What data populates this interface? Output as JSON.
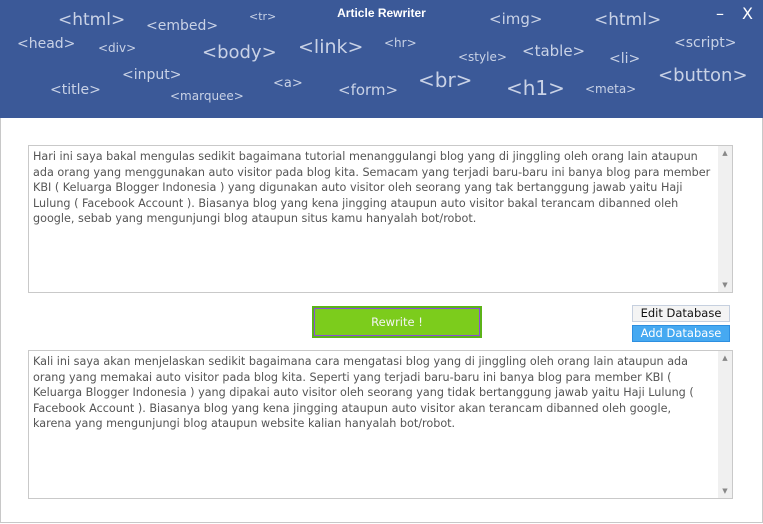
{
  "window": {
    "title": "Article Rewriter",
    "minimize_label": "–",
    "close_label": "X"
  },
  "header_tags": [
    "<html>",
    "<embed>",
    "<tr>",
    "<img>",
    "<html>",
    "<head>",
    "<div>",
    "<body>",
    "<link>",
    "<hr>",
    "<style>",
    "<table>",
    "<li>",
    "<script>",
    "<input>",
    "<title>",
    "<marquee>",
    "<a>",
    "<form>",
    "<br>",
    "<h1>",
    "<meta>",
    "<button>"
  ],
  "colors": {
    "header": "#3b5998",
    "rewrite": "#7ccc1c",
    "add_database": "#46a9f1"
  },
  "input_text": "Hari ini saya bakal mengulas sedikit bagaimana tutorial menanggulangi blog yang di jinggling oleh orang lain ataupun ada orang yang menggunakan auto visitor pada blog kita. Semacam yang terjadi baru-baru ini banya blog para member KBI ( Keluarga Blogger Indonesia ) yang digunakan auto visitor oleh seorang yang tak bertanggung jawab yaitu Haji Lulung ( Facebook Account ). Biasanya blog yang kena jingging ataupun auto visitor bakal terancam dibanned oleh google, sebab yang mengunjungi blog ataupun situs kamu hanyalah bot/robot.",
  "buttons": {
    "rewrite": "Rewrite !",
    "edit_database": "Edit Database",
    "add_database": "Add Database"
  },
  "output_text": "Kali ini saya akan menjelaskan sedikit bagaimana cara mengatasi blog yang di jinggling oleh orang lain ataupun ada orang yang memakai auto visitor pada blog kita. Seperti yang terjadi baru-baru ini banya blog para member KBI ( Keluarga Blogger Indonesia ) yang dipakai auto visitor oleh seorang yang tidak bertanggung jawab yaitu Haji Lulung ( Facebook Account ). Biasanya blog yang kena jingging ataupun auto visitor akan terancam dibanned oleh google, karena yang mengunjungi blog ataupun website kalian hanyalah bot/robot."
}
